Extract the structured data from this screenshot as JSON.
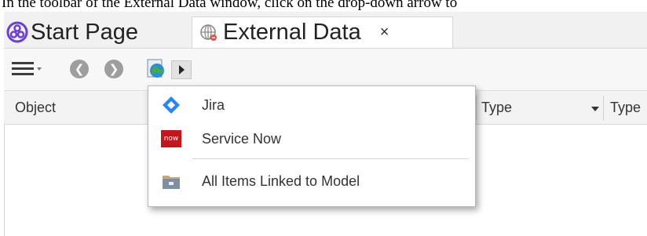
{
  "caption": "In the toolbar of the External Data window, click on the drop-down arrow to",
  "tabs": [
    {
      "label": "Start Page",
      "icon": "start-page-icon",
      "active": false
    },
    {
      "label": "External Data",
      "icon": "external-data-icon",
      "active": true
    }
  ],
  "tab_close_glyph": "×",
  "toolbar": {
    "buttons": [
      "menu-icon",
      "back-icon",
      "forward-icon",
      "globe-icon",
      "dropdown-arrow-icon"
    ]
  },
  "columns": [
    "Object",
    "Type",
    "Type"
  ],
  "dropdown_menu": {
    "items": [
      {
        "label": "Jira",
        "icon": "jira-icon",
        "color": "#2684FF"
      },
      {
        "label": "Service Now",
        "icon": "servicenow-icon",
        "badge_text": "now",
        "color": "#C4161C"
      },
      {
        "label": "All Items Linked to Model",
        "icon": "folder-linked-icon"
      }
    ]
  },
  "colors": {
    "accent_blue": "#2684FF",
    "servicenow_red": "#C4161C",
    "start_page_purple": "#6A3FD4"
  }
}
